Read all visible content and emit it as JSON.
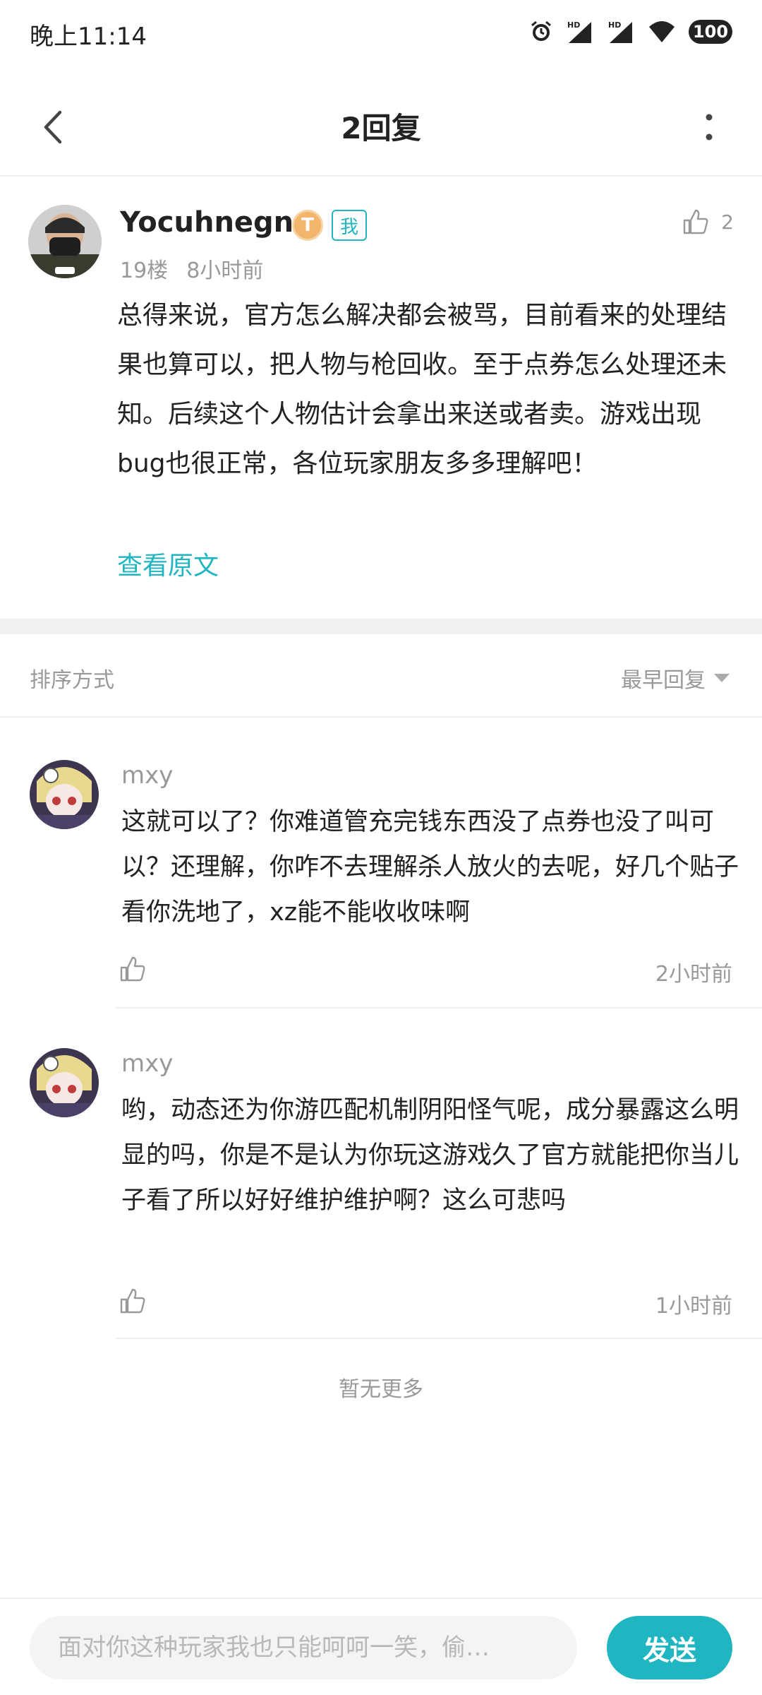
{
  "status_bar": {
    "time": "晚上11:14",
    "battery": "100",
    "icons": [
      "alarm-icon",
      "hd-signal-icon",
      "hd-signal-icon",
      "wifi-icon",
      "battery-icon"
    ]
  },
  "header": {
    "title": "2回复",
    "back_icon": "chevron-left-icon",
    "more_icon": "more-vertical-icon"
  },
  "post": {
    "username": "Yocuhnegn.i",
    "level_badge": "T",
    "me_badge": "我",
    "like_count": "2",
    "floor": "19楼",
    "time": "8小时前",
    "body": "总得来说，官方怎么解决都会被骂，目前看来的处理结果也算可以，把人物与枪回收。至于点券怎么处理还未知。后续这个人物估计会拿出来送或者卖。游戏出现bug也很正常，各位玩家朋友多多理解吧！",
    "view_original": "查看原文"
  },
  "sort": {
    "label": "排序方式",
    "selected": "最早回复"
  },
  "replies": [
    {
      "name": "mxy",
      "body": "这就可以了？你难道管充完钱东西没了点券也没了叫可以？还理解，你咋不去理解杀人放火的去呢，好几个贴子看你洗地了，xz能不能收收味啊",
      "time": "2小时前"
    },
    {
      "name": "mxy",
      "body": "哟，动态还为你游匹配机制阴阳怪气呢，成分暴露这么明显的吗，你是不是认为你玩这游戏久了官方就能把你当儿子看了所以好好维护维护啊？这么可悲吗",
      "time": "1小时前"
    }
  ],
  "footer_text": "暂无更多",
  "input": {
    "placeholder": "面对你这种玩家我也只能呵呵一笑，偷…",
    "send_label": "发送"
  },
  "colors": {
    "accent": "#1fb6c1",
    "muted_text": "#999999",
    "body_text": "#222222",
    "divider": "#eeeeee"
  }
}
